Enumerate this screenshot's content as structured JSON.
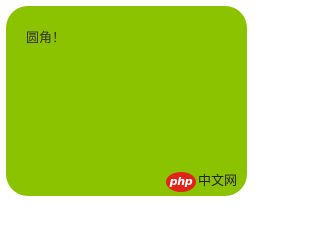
{
  "box": {
    "text": "圆角！",
    "background_color": "#8cc300"
  },
  "watermark": {
    "logo_text": "php",
    "site_text": "中文网",
    "logo_color": "#e2231a"
  }
}
